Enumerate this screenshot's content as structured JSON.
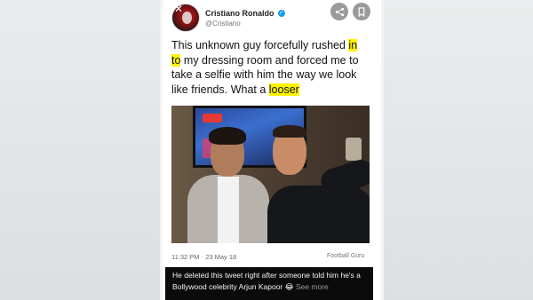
{
  "tweet": {
    "display_name": "Cristiano Ronaldo",
    "handle": "@Cristiano",
    "text_segments": [
      "This unknown guy forcefully rushed ",
      "in",
      " ",
      "to",
      " my dressing room and forced me to take a selfie with him the way we look like friends. What a ",
      "looser"
    ],
    "timestamp": "11:32 PM · 23 May 18",
    "source": "Football Guru"
  },
  "icons": {
    "close": "close-icon",
    "share": "share-icon",
    "bookmark": "bookmark-icon",
    "verified": "verified-badge-icon"
  },
  "caption": {
    "text": "He deleted this tweet right after someone told him he's a Bollywood celebrity Arjun Kapoor 😂",
    "see_more": "See more"
  },
  "colors": {
    "highlight": "#fff200",
    "verified": "#1d9bf0",
    "caption_bg": "#0b0b0b"
  }
}
